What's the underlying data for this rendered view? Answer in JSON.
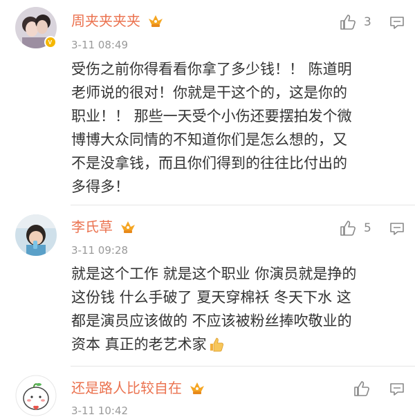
{
  "comments": [
    {
      "username": "周夹夹夹夹",
      "time": "3-11 08:49",
      "likes": "3",
      "lines": [
        "受伤之前你得看看你拿了多少钱！！ 陈道明",
        "老师说的很对！你就是干这个的，这是你的",
        "职业！！ 那些一天受个小伤还要摆拍发个微",
        "博博大众同情的不知道你们是怎么想的，又",
        "不是没拿钱，而且你们得到的往往比付出的",
        "多得多！"
      ]
    },
    {
      "username": "李氏草",
      "time": "3-11 09:28",
      "likes": "5",
      "lines": [
        "就是这个工作 就是这个职业 你演员就是挣的",
        "这份钱 什么手破了 夏天穿棉袄 冬天下水 这",
        "都是演员应该做的 不应该被粉丝捧吹敬业的",
        "资本 真正的老艺术家"
      ]
    },
    {
      "username": "还是路人比较自在",
      "time": "3-11 10:42",
      "likes": "",
      "lines": []
    }
  ],
  "colors": {
    "username": "#eb7350",
    "time": "#999999",
    "text": "#333333",
    "icon": "#888888"
  }
}
